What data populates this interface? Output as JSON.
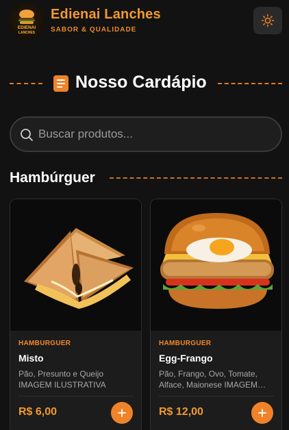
{
  "header": {
    "logo_text": "EDIENAI LANCHES",
    "brand_name": "Edienai Lanches",
    "tagline": "SABOR & QUALIDADE",
    "theme_icon": "sun-icon"
  },
  "menu": {
    "title": "Nosso Cardápio",
    "icon": "menu-list-icon"
  },
  "search": {
    "placeholder": "Buscar produtos...",
    "value": "",
    "icon": "search-icon"
  },
  "category": {
    "title": "Hambúrguer",
    "products": [
      {
        "category": "HAMBURGUER",
        "name": "Misto",
        "description": "Pão, Presunto e Queijo IMAGEM ILUSTRATIVA",
        "price": "R$ 6,00",
        "image": "toasted-sandwich-image"
      },
      {
        "category": "HAMBURGUER",
        "name": "Egg-Frango",
        "description": "Pão, Frango, Ovo, Tomate, Alface, Maionese IMAGEM ILUSTRATIVA",
        "price": "R$ 12,00",
        "image": "chicken-egg-burger-image"
      }
    ]
  },
  "colors": {
    "background": "#121212",
    "accent": "#f0832a",
    "card": "#1c1c1c"
  }
}
